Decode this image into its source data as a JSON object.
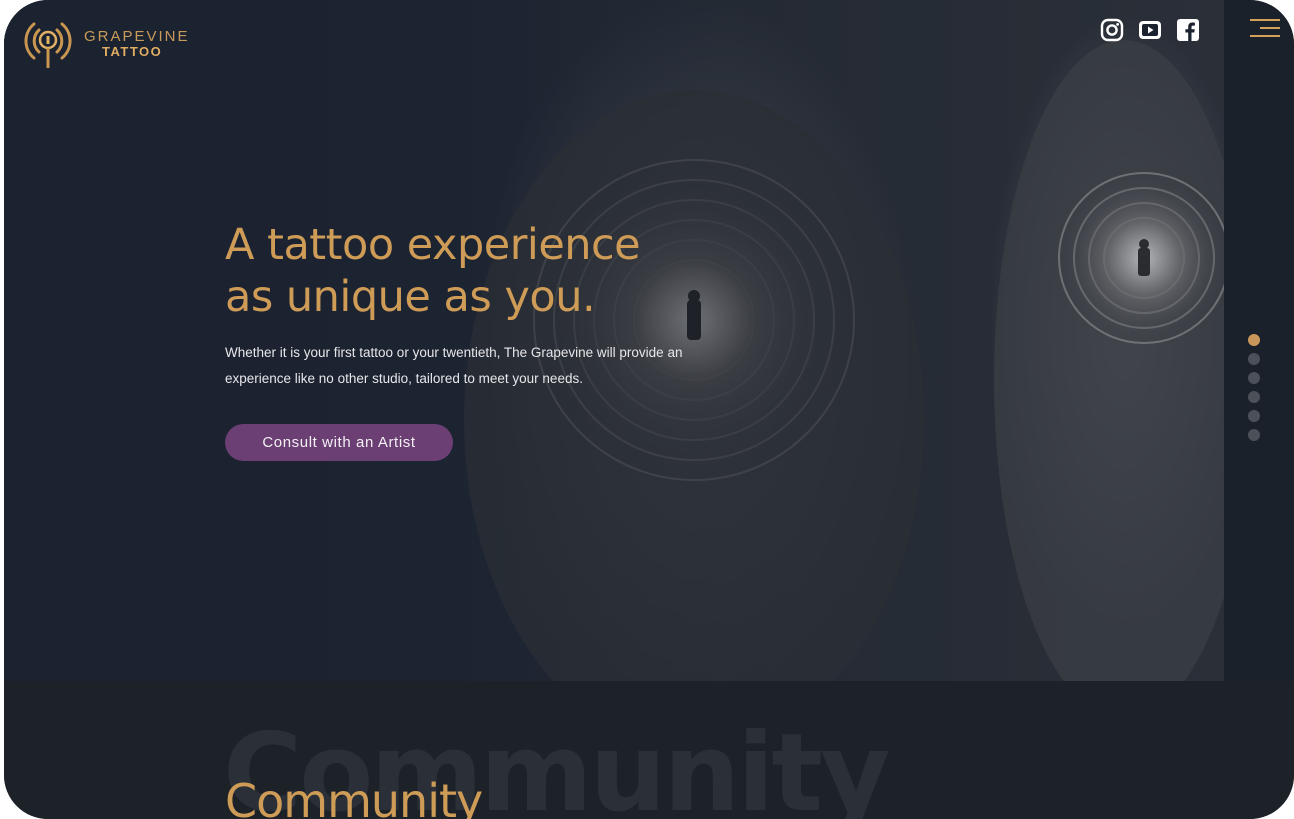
{
  "brand": {
    "name_line1": "GRAPEVINE",
    "name_line2": "TATTOO",
    "logo_icon": "microphone-waves-icon",
    "accent_color": "#cf9c57",
    "button_color": "#6b3f73",
    "background_color": "#1b2029"
  },
  "header": {
    "social": [
      {
        "name": "instagram",
        "icon": "instagram-icon"
      },
      {
        "name": "youtube",
        "icon": "youtube-icon"
      },
      {
        "name": "facebook",
        "icon": "facebook-icon"
      }
    ],
    "menu_icon": "hamburger-menu-icon"
  },
  "hero": {
    "headline_line1": "A tattoo experience",
    "headline_line2": "as unique as you.",
    "subtext": "Whether it is your first tattoo or your twentieth, The Grapevine will provide an experience like no other studio, tailored to meet your needs.",
    "cta_label": "Consult with an Artist"
  },
  "slider": {
    "total_slides": 6,
    "active_index": 0
  },
  "next_section": {
    "title": "Community",
    "ghost_title": "Community"
  }
}
